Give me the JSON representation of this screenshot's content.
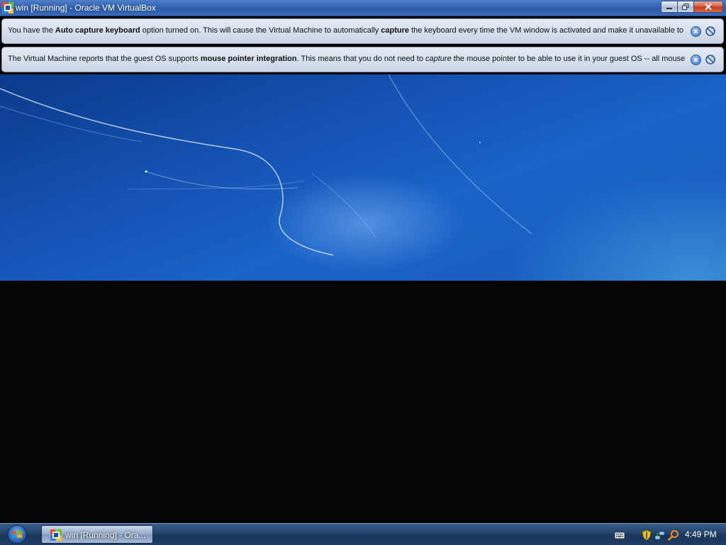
{
  "window": {
    "title": "win [Running] - Oracle VM VirtualBox",
    "icon": "virtualbox-icon",
    "buttons": [
      "minimize",
      "restore",
      "close"
    ]
  },
  "notifications": [
    {
      "segments": [
        {
          "text": "You have the ",
          "style": "normal"
        },
        {
          "text": "Auto capture keyboard",
          "style": "bold"
        },
        {
          "text": " option turned on. This will cause the Virtual Machine to automatically ",
          "style": "normal"
        },
        {
          "text": "capture",
          "style": "bold"
        },
        {
          "text": " the keyboard every time the VM window is activated and make it unavailable to",
          "style": "normal"
        }
      ]
    },
    {
      "segments": [
        {
          "text": "The Virtual Machine reports that the guest OS supports ",
          "style": "normal"
        },
        {
          "text": "mouse pointer integration",
          "style": "bold"
        },
        {
          "text": ". This means that you do not need to ",
          "style": "normal"
        },
        {
          "text": "capture",
          "style": "italic"
        },
        {
          "text": " the mouse pointer to be able to use it in your guest OS -- all mouse",
          "style": "normal"
        }
      ]
    }
  ],
  "taskbar": {
    "task_label": "win [Running] - Ora...",
    "clock": "4:49 PM"
  },
  "colors": {
    "desktop_blue": "#1552b3",
    "taskbar": "#23426b",
    "notice_bg": "#dbe3ef"
  }
}
